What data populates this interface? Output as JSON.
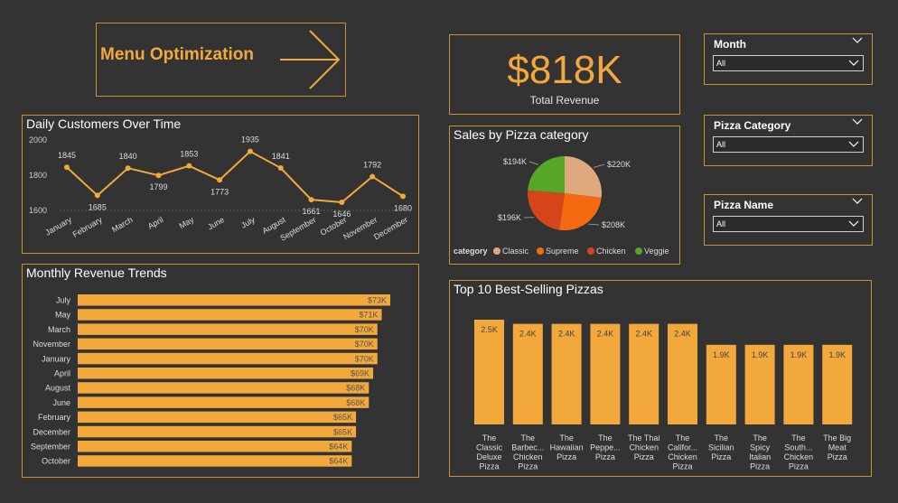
{
  "title": {
    "text": "Menu Optimization"
  },
  "kpi": {
    "value": "$818K",
    "label": "Total Revenue"
  },
  "slicers": [
    {
      "title": "Month",
      "value": "All"
    },
    {
      "title": "Pizza Category",
      "value": "All"
    },
    {
      "title": "Pizza Name",
      "value": "All"
    }
  ],
  "colors": {
    "accent": "#f3a83c",
    "border": "#c9922e",
    "background": "#333333"
  },
  "chart_data": [
    {
      "type": "line",
      "title": "Daily Customers Over Time",
      "x": [
        "January",
        "February",
        "March",
        "April",
        "May",
        "June",
        "July",
        "August",
        "September",
        "October",
        "November",
        "December"
      ],
      "series": [
        {
          "values": [
            1845,
            1685,
            1840,
            1799,
            1853,
            1773,
            1935,
            1841,
            1661,
            1646,
            1792,
            1680
          ]
        }
      ],
      "ylim": [
        1600,
        2000
      ],
      "yticks": [
        "1600",
        "1800",
        "2000"
      ],
      "grid": false
    },
    {
      "type": "bar",
      "orientation": "horizontal",
      "title": "Monthly Revenue Trends",
      "categories": [
        "July",
        "May",
        "March",
        "November",
        "January",
        "April",
        "August",
        "June",
        "February",
        "December",
        "September",
        "October"
      ],
      "values": [
        73,
        71,
        70,
        70,
        70,
        69,
        68,
        68,
        65,
        65,
        64,
        64
      ],
      "labels": [
        "$73K",
        "$71K",
        "$70K",
        "$70K",
        "$70K",
        "$69K",
        "$68K",
        "$68K",
        "$65K",
        "$65K",
        "$64K",
        "$64K"
      ]
    },
    {
      "type": "pie",
      "title": "Sales by Pizza category",
      "legend_title": "category",
      "categories": [
        "Classic",
        "Supreme",
        "Chicken",
        "Veggie"
      ],
      "values": [
        220,
        208,
        196,
        194
      ],
      "labels": [
        "$220K",
        "$208K",
        "$196K",
        "$194K"
      ],
      "colors": [
        "#e0a87f",
        "#f56a10",
        "#d6451a",
        "#56a628"
      ]
    },
    {
      "type": "bar",
      "title": "Top 10 Best-Selling Pizzas",
      "categories": [
        [
          "The",
          "Classic",
          "Deluxe",
          "Pizza"
        ],
        [
          "The",
          "Barbec...",
          "Chicken",
          "Pizza"
        ],
        [
          "The",
          "Hawaiian",
          "Pizza"
        ],
        [
          "The",
          "Peppe...",
          "Pizza"
        ],
        [
          "The Thai",
          "Chicken",
          "Pizza"
        ],
        [
          "The",
          "Califor...",
          "Chicken",
          "Pizza"
        ],
        [
          "The",
          "Sicilian",
          "Pizza"
        ],
        [
          "The",
          "Spicy",
          "Italian",
          "Pizza"
        ],
        [
          "The",
          "South...",
          "Chicken",
          "Pizza"
        ],
        [
          "The Big",
          "Meat",
          "Pizza"
        ]
      ],
      "values": [
        2.5,
        2.4,
        2.4,
        2.4,
        2.4,
        2.4,
        1.9,
        1.9,
        1.9,
        1.9
      ],
      "labels": [
        "2.5K",
        "2.4K",
        "2.4K",
        "2.4K",
        "2.4K",
        "2.4K",
        "1.9K",
        "1.9K",
        "1.9K",
        "1.9K"
      ]
    }
  ]
}
